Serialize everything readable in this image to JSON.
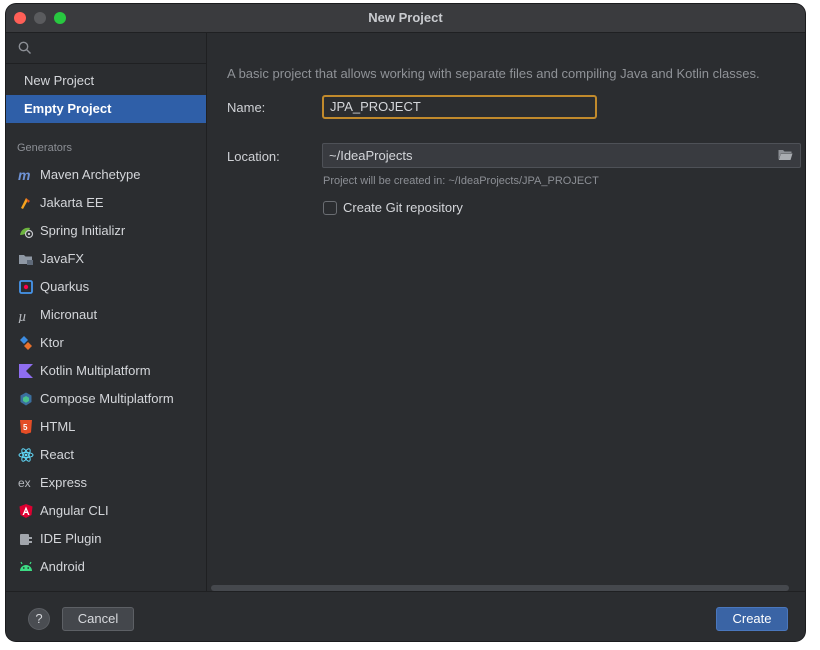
{
  "window": {
    "title": "New Project"
  },
  "search": {
    "placeholder": ""
  },
  "sidebar": {
    "top_items": [
      {
        "label": "New Project",
        "selected": false
      },
      {
        "label": "Empty Project",
        "selected": true
      }
    ],
    "section_title": "Generators",
    "generators": [
      {
        "label": "Maven Archetype",
        "icon": "maven-icon"
      },
      {
        "label": "Jakarta EE",
        "icon": "jakarta-icon"
      },
      {
        "label": "Spring Initializr",
        "icon": "spring-icon"
      },
      {
        "label": "JavaFX",
        "icon": "javafx-icon"
      },
      {
        "label": "Quarkus",
        "icon": "quarkus-icon"
      },
      {
        "label": "Micronaut",
        "icon": "micronaut-icon"
      },
      {
        "label": "Ktor",
        "icon": "ktor-icon"
      },
      {
        "label": "Kotlin Multiplatform",
        "icon": "kotlin-icon"
      },
      {
        "label": "Compose Multiplatform",
        "icon": "compose-icon"
      },
      {
        "label": "HTML",
        "icon": "html5-icon"
      },
      {
        "label": "React",
        "icon": "react-icon"
      },
      {
        "label": "Express",
        "icon": "express-icon"
      },
      {
        "label": "Angular CLI",
        "icon": "angular-icon"
      },
      {
        "label": "IDE Plugin",
        "icon": "plugin-icon"
      },
      {
        "label": "Android",
        "icon": "android-icon"
      }
    ]
  },
  "main": {
    "description": "A basic project that allows working with separate files and compiling Java and Kotlin classes.",
    "name_label": "Name:",
    "name_value": "JPA_PROJECT",
    "location_label": "Location:",
    "location_value": "~/IdeaProjects",
    "location_hint": "Project will be created in: ~/IdeaProjects/JPA_PROJECT",
    "git_checkbox_label": "Create Git repository",
    "git_checked": false
  },
  "footer": {
    "help_label": "?",
    "cancel_label": "Cancel",
    "create_label": "Create"
  },
  "colors": {
    "selection": "#2f5fa8",
    "focus_border": "#c18a2c",
    "primary_button": "#3a64a5"
  }
}
